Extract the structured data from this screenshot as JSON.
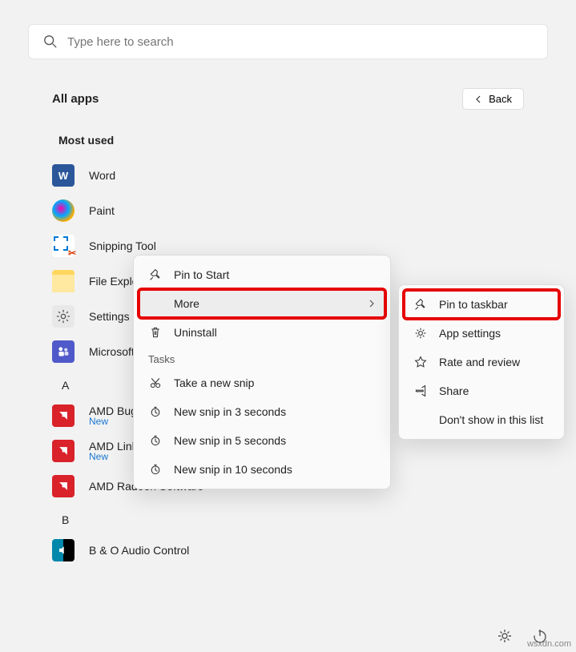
{
  "search": {
    "placeholder": "Type here to search"
  },
  "header": {
    "title": "All apps",
    "back": "Back"
  },
  "section": {
    "mostUsed": "Most used"
  },
  "apps": {
    "mostUsed": [
      {
        "label": "Word"
      },
      {
        "label": "Paint"
      },
      {
        "label": "Snipping Tool"
      },
      {
        "label": "File Explorer"
      },
      {
        "label": "Settings"
      },
      {
        "label": "Microsoft Teams"
      }
    ],
    "letterA": "A",
    "aItems": [
      {
        "label": "AMD Bug Report Tool",
        "badge": "New"
      },
      {
        "label": "AMD Link",
        "badge": "New"
      },
      {
        "label": "AMD Radeon Software"
      }
    ],
    "letterB": "B",
    "bItems": [
      {
        "label": "B & O Audio Control"
      }
    ]
  },
  "context1": {
    "pinStart": "Pin to Start",
    "more": "More",
    "uninstall": "Uninstall",
    "tasksHeader": "Tasks",
    "tasks": [
      "Take a new snip",
      "New snip in 3 seconds",
      "New snip in 5 seconds",
      "New snip in 10 seconds"
    ]
  },
  "context2": {
    "pinTaskbar": "Pin to taskbar",
    "appSettings": "App settings",
    "rate": "Rate and review",
    "share": "Share",
    "dontShow": "Don't show in this list"
  },
  "watermark": "wsxdn.com"
}
